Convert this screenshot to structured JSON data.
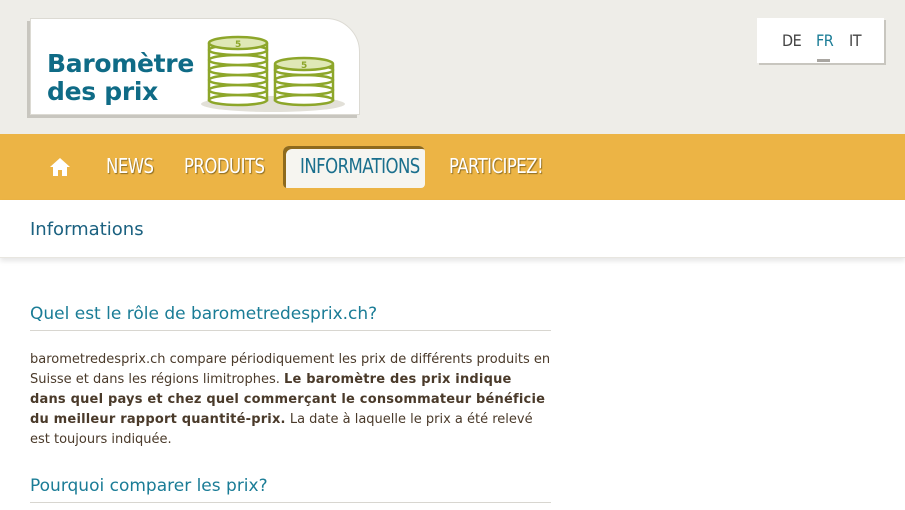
{
  "logo": {
    "line1": "Baromètre",
    "line2": "des prix"
  },
  "languages": [
    {
      "code": "DE",
      "active": false
    },
    {
      "code": "FR",
      "active": true
    },
    {
      "code": "IT",
      "active": false
    }
  ],
  "nav": {
    "home_icon": "home-icon",
    "items": [
      "NEWS",
      "PRODUITS",
      "INFORMATIONS",
      "PARTICIPEZ!"
    ],
    "active": "INFORMATIONS"
  },
  "breadcrumb": {
    "title": "Informations"
  },
  "content": {
    "sections": [
      {
        "heading": "Quel est le rôle de barometredesprix.ch?",
        "text_plain_1": "barometredesprix.ch compare périodiquement les prix de différents produits en Suisse et dans les régions limitrophes. ",
        "text_bold": "Le baromètre des prix indique dans quel pays et chez quel commerçant le consommateur bénéficie du meilleur rapport quantité-prix.",
        "text_plain_2": " La date à laquelle le prix a été relevé est toujours indiquée."
      },
      {
        "heading": "Pourquoi comparer les prix?"
      }
    ]
  },
  "colors": {
    "header_bg": "#eeede8",
    "nav_bg": "#ecb445",
    "accent": "#1a7c96",
    "text": "#4a3a2a",
    "coin": "#8da62a"
  }
}
